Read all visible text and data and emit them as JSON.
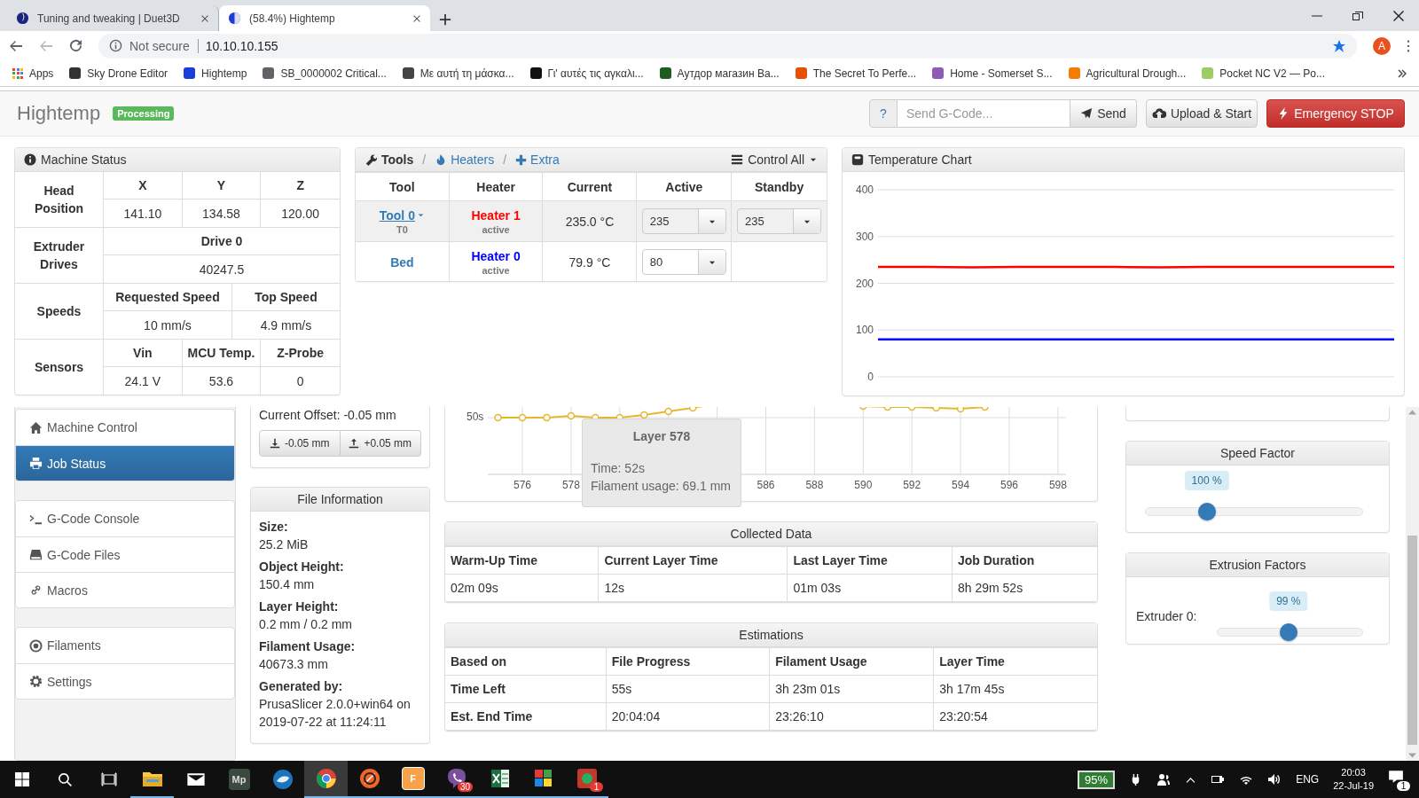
{
  "browser": {
    "tabs": [
      {
        "title": "Tuning and tweaking | Duet3D",
        "selected": false
      },
      {
        "title": "(58.4%) Hightemp",
        "selected": true
      }
    ],
    "security": "Not secure",
    "url": "10.10.10.155",
    "profile": "A",
    "apps": "Apps",
    "bookmarks": [
      {
        "label": "Sky Drone Editor",
        "color": "#333333"
      },
      {
        "label": "Hightemp",
        "color": "#1a3fd6"
      },
      {
        "label": "SB_0000002 Critical...",
        "color": "#5f6368"
      },
      {
        "label": "Με αυτή τη μάσκα...",
        "color": "#444444"
      },
      {
        "label": "Γι' αυτές τις αγκαλι...",
        "color": "#111111"
      },
      {
        "label": "Аутдор магазин Ва...",
        "color": "#1b5e20"
      },
      {
        "label": "The Secret To Perfe...",
        "color": "#e65100"
      },
      {
        "label": "Home - Somerset S...",
        "color": "#8e5bb5"
      },
      {
        "label": "Agricultural Drough...",
        "color": "#f57c00"
      },
      {
        "label": "Pocket NC V2 — Po...",
        "color": "#9ccc65"
      }
    ]
  },
  "navbar": {
    "title": "Hightemp",
    "status": "Processing",
    "help": "?",
    "gcode_placeholder": "Send G-Code...",
    "send": "Send",
    "upload": "Upload & Start",
    "stop": "Emergency STOP"
  },
  "machine_status": {
    "title": "Machine Status",
    "groups": [
      {
        "label": "Head Position",
        "columns": [
          "X",
          "Y",
          "Z"
        ],
        "values": [
          "141.10",
          "134.58",
          "120.00"
        ]
      },
      {
        "label": "Extruder Drives",
        "columns": [
          "Drive 0"
        ],
        "values": [
          "40247.5"
        ]
      },
      {
        "label": "Speeds",
        "columns": [
          "Requested Speed",
          "Top Speed"
        ],
        "values": [
          "10 mm/s",
          "4.9 mm/s"
        ]
      },
      {
        "label": "Sensors",
        "columns": [
          "Vin",
          "MCU Temp.",
          "Z-Probe"
        ],
        "values": [
          "24.1 V",
          "53.6",
          "0"
        ]
      }
    ]
  },
  "tools": {
    "title": "Tools",
    "links": [
      {
        "separator": "/",
        "label": "Heaters"
      },
      {
        "separator": "/",
        "label": "Extra"
      }
    ],
    "control_all": "Control All",
    "columns": [
      "Tool",
      "Heater",
      "Current",
      "Active",
      "Standby"
    ],
    "rows": [
      {
        "kind": "tool",
        "tool": "Tool 0",
        "tool_sub": "T0",
        "heater": "Heater 1",
        "color": "#ff0000",
        "heater_state": "active",
        "current": "235.0 °C",
        "active": "235",
        "standby": "235",
        "selected": true
      },
      {
        "kind": "bed",
        "tool": "Bed",
        "heater": "Heater 0",
        "color": "#0000ff",
        "heater_state": "active",
        "current": "79.9 °C",
        "active": "80",
        "selected": false
      }
    ]
  },
  "temperature_chart": {
    "title": "Temperature Chart",
    "chart_data": {
      "type": "line",
      "grid": true,
      "ylim": [
        0,
        400
      ],
      "yticks": [
        0,
        100,
        200,
        300,
        400
      ],
      "series": [
        {
          "color": "#ff0000",
          "values": [
            235,
            235,
            234,
            235,
            235,
            235,
            234,
            235,
            235,
            235,
            235,
            235
          ]
        },
        {
          "color": "#0000ff",
          "values": [
            80,
            80,
            80,
            80,
            80,
            80,
            80,
            80,
            80,
            80,
            80,
            80
          ]
        }
      ]
    }
  },
  "sidebar": {
    "groups": [
      [
        {
          "label": "Machine Control",
          "kind": "home",
          "selected": false
        },
        {
          "label": "Job Status",
          "kind": "print",
          "selected": true
        }
      ],
      [
        {
          "label": "G-Code Console",
          "kind": "terminal",
          "selected": false
        },
        {
          "label": "G-Code Files",
          "kind": "files",
          "selected": false
        },
        {
          "label": "Macros",
          "kind": "link",
          "selected": false
        }
      ],
      [
        {
          "label": "Filaments",
          "kind": "filament",
          "selected": false
        },
        {
          "label": "Settings",
          "kind": "gear",
          "selected": false
        }
      ]
    ]
  },
  "offset": {
    "label": "Current Offset: -0.05 mm",
    "buttons": [
      {
        "kind": "down",
        "label": "-0.05 mm"
      },
      {
        "kind": "up",
        "label": "+0.05 mm"
      }
    ]
  },
  "file_information": {
    "title": "File Information",
    "items": [
      {
        "label": "Size:",
        "value": "25.2 MiB"
      },
      {
        "label": "Object Height:",
        "value": "150.4 mm"
      },
      {
        "label": "Layer Height:",
        "value": "0.2 mm / 0.2 mm"
      },
      {
        "label": "Filament Usage:",
        "value": "40673.3 mm"
      },
      {
        "label": "Generated by:",
        "value": "PrusaSlicer 2.0.0+win64 on 2019-07-22 at 11:24:11"
      }
    ]
  },
  "layer_chart": {
    "y_label": "50s",
    "x_ticks": [
      "576",
      "578",
      "586",
      "588",
      "590",
      "592",
      "594",
      "596",
      "598"
    ],
    "tooltip": {
      "title": "Layer 578",
      "lines": [
        "Time: 52s",
        "Filament usage: 69.1 mm"
      ]
    }
  },
  "collected_data": {
    "title": "Collected Data",
    "columns": [
      "Warm-Up Time",
      "Current Layer Time",
      "Last Layer Time",
      "Job Duration"
    ],
    "values": [
      "02m 09s",
      "12s",
      "01m 03s",
      "8h 29m 52s"
    ]
  },
  "estimations": {
    "title": "Estimations",
    "columns": [
      "Based on",
      "File Progress",
      "Filament Usage",
      "Layer Time"
    ],
    "rows": [
      [
        "Time Left",
        "55s",
        "3h 23m 01s",
        "3h 17m 45s"
      ],
      [
        "Est. End Time",
        "20:04:04",
        "23:26:10",
        "23:20:54"
      ]
    ]
  },
  "speed_factor": {
    "title": "Speed Factor",
    "value": "100 %",
    "level": 0.283
  },
  "extrusion_factors": {
    "title": "Extrusion Factors",
    "extruders": [
      {
        "label": "Extruder 0:",
        "value": "99 %",
        "level": 0.49
      }
    ]
  },
  "taskbar": {
    "apps": [
      {
        "kind": "explorer",
        "running": true
      },
      {
        "kind": "mail",
        "running": false
      },
      {
        "kind": "mp",
        "label": "Mp",
        "running": false
      },
      {
        "kind": "blue",
        "running": false
      },
      {
        "kind": "chrome",
        "running": true,
        "selected": true
      },
      {
        "kind": "orange",
        "running": true
      },
      {
        "kind": "f",
        "label": "F",
        "running": true
      },
      {
        "kind": "viber",
        "running": true,
        "badge": "30"
      },
      {
        "kind": "excel",
        "running": true
      },
      {
        "kind": "blocks",
        "running": true
      },
      {
        "kind": "app",
        "running": true,
        "badge": "1"
      }
    ],
    "battery": "95%",
    "language": "ENG",
    "time": "20:03",
    "date": "22-Jul-19",
    "notifications": "1"
  }
}
